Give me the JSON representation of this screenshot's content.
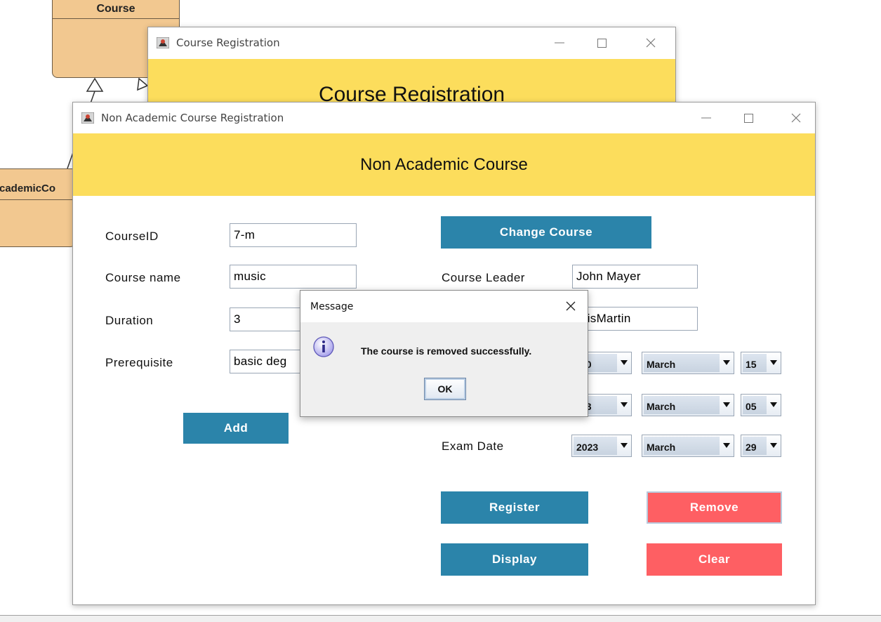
{
  "diagram": {
    "course_class": "Course",
    "academic_class": "cademicCo"
  },
  "back_window": {
    "title": "Course Registration",
    "header": "Course Registration"
  },
  "main_window": {
    "title": "Non Academic Course Registration",
    "header": "Non Academic Course",
    "left_form": {
      "course_id_label": "CourseID",
      "course_id_value": "7-m",
      "course_name_label": "Course name",
      "course_name_value": "music",
      "duration_label": "Duration",
      "duration_value": "3",
      "prerequisite_label": "Prerequisite",
      "prerequisite_value": "basic deg"
    },
    "buttons": {
      "add": "Add",
      "change_course": "Change Course",
      "register": "Register",
      "remove": "Remove",
      "display": "Display",
      "clear": "Clear"
    },
    "right_form": {
      "course_leader_label": "Course Leader",
      "course_leader_value": "John Mayer",
      "instructor_value": "hrisMartin",
      "row1": {
        "year": "20",
        "month": "March",
        "day": "15"
      },
      "row2": {
        "year": "23",
        "month": "March",
        "day": "05"
      },
      "exam_date_label": "Exam Date",
      "exam": {
        "year": "2023",
        "month": "March",
        "day": "29"
      }
    }
  },
  "dialog": {
    "title": "Message",
    "message": "The course is removed successfully.",
    "ok": "OK"
  },
  "icons": {
    "app": "java-app-icon",
    "minimize": "minimize-icon",
    "maximize": "maximize-icon",
    "close": "close-icon",
    "info": "info-icon",
    "dropdown": "chevron-down-icon"
  },
  "colors": {
    "header_yellow": "#fcdd5c",
    "button_blue": "#2b84aa",
    "button_red": "#fe5f63",
    "uml_fill": "#f2c890"
  }
}
